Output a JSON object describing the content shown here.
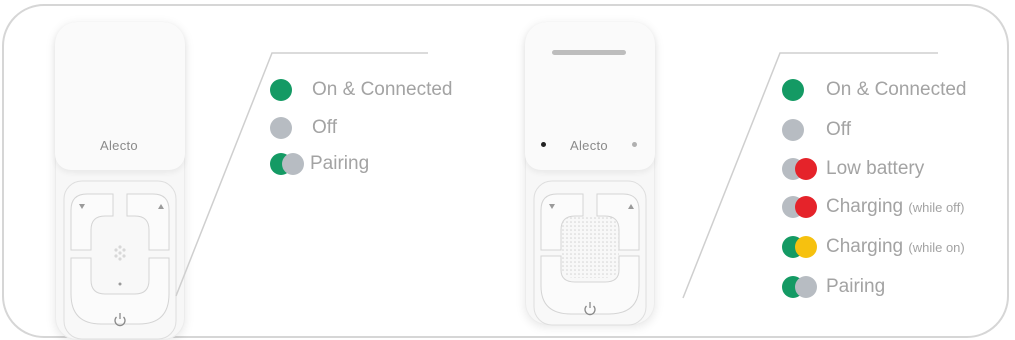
{
  "colors": {
    "green": "#149a64",
    "grey": "#b7bcc2",
    "red": "#e5232a",
    "yellow": "#f6c10f",
    "text": "#a3a3a3",
    "frame": "#d6d6d6"
  },
  "left_device": {
    "brand": "Alecto",
    "legend": [
      {
        "label": "On & Connected",
        "leds": [
          "green"
        ]
      },
      {
        "label": "Off",
        "leds": [
          "grey"
        ]
      },
      {
        "label": "Pairing",
        "leds": [
          "green",
          "grey"
        ]
      }
    ]
  },
  "right_device": {
    "brand": "Alecto",
    "legend": [
      {
        "label": "On & Connected",
        "note": "",
        "leds": [
          "green"
        ]
      },
      {
        "label": "Off",
        "note": "",
        "leds": [
          "grey"
        ]
      },
      {
        "label": "Low battery",
        "note": "",
        "leds": [
          "grey",
          "red"
        ]
      },
      {
        "label": "Charging",
        "note": "(while off)",
        "leds": [
          "grey",
          "red"
        ]
      },
      {
        "label": "Charging",
        "note": "(while on)",
        "leds": [
          "green",
          "yellow"
        ]
      },
      {
        "label": "Pairing",
        "note": "",
        "leds": [
          "green",
          "grey"
        ]
      }
    ]
  },
  "icons": {
    "volume_down": "triangle-down-icon",
    "volume_up": "triangle-up-icon",
    "power": "power-icon",
    "speaker": "speaker-grille-icon",
    "microphone": "microphone-icon"
  }
}
